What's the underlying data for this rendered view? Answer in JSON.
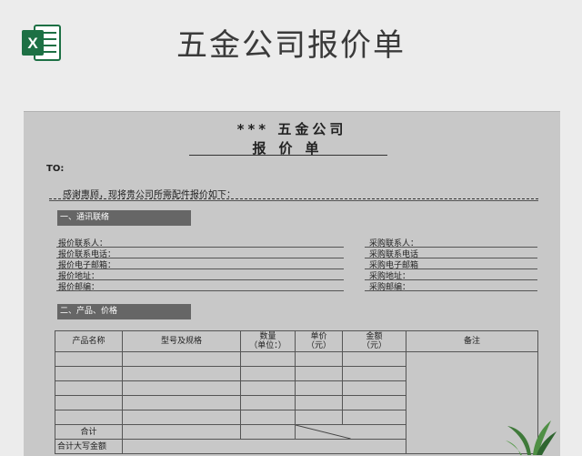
{
  "banner": {
    "title": "五金公司报价单",
    "app_icon": "excel-icon",
    "icon_letter": "X",
    "icon_color": "#1d7044"
  },
  "sheet": {
    "company": "*** 五金公司",
    "quote_title": "报价单",
    "to_label": "TO:",
    "greeting": "感谢惠顾，现将贵公司所需配件报价如下：",
    "section1": "一、通讯联络",
    "left_fields": [
      "报价联系人：",
      "报价联系电话：",
      "报价电子邮箱：",
      "报价地址：",
      "报价邮编："
    ],
    "right_fields": [
      "采购联系人：",
      "采购联系电话",
      "采购电子邮箱",
      "采购地址：",
      "采购邮编："
    ],
    "section2": "二、产品、价格",
    "table": {
      "headers": {
        "product": "产品名称",
        "model": "型号及规格",
        "qty": "数量",
        "qty_unit": "（单位：）",
        "price": "单价",
        "price_unit": "（元）",
        "amount": "金额",
        "amount_unit": "（元）",
        "remark": "备注"
      },
      "subtotal_label": "合计",
      "total_caps_label": "合计大写金额"
    }
  }
}
